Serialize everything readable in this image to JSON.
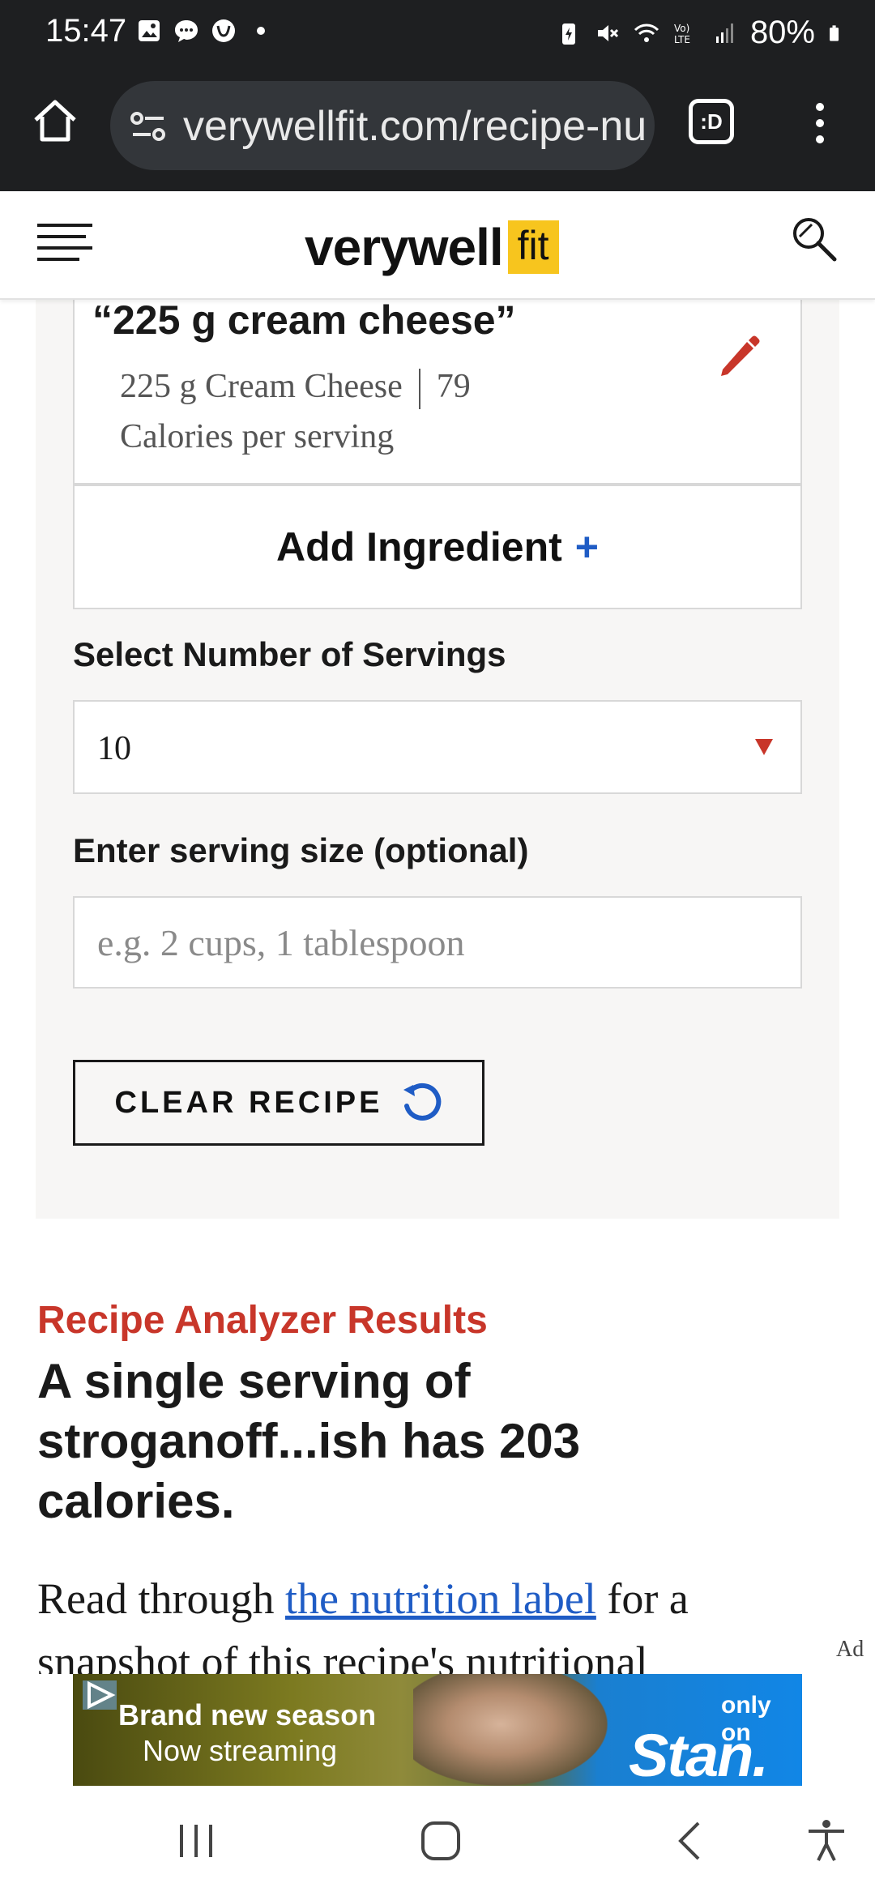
{
  "status_bar": {
    "time": "15:47",
    "battery": "80%",
    "notification_icons": [
      "gallery-icon",
      "chat-icon",
      "woolworths-icon",
      "dot-icon"
    ],
    "system_icons": [
      "battery-saver-icon",
      "mute-icon",
      "wifi-icon",
      "volte-icon",
      "signal-icon",
      "battery-icon"
    ]
  },
  "browser": {
    "url": "verywellfit.com/recipe-nu",
    "tab_label": ":D"
  },
  "site": {
    "logo_word": "verywell",
    "logo_badge": "fit"
  },
  "ingredient": {
    "title": "“225 g cream cheese”",
    "name": "225 g Cream Cheese",
    "calories": "79",
    "calories_label": "Calories per serving"
  },
  "calculator": {
    "add_ingredient_label": "Add Ingredient",
    "add_icon": "+",
    "servings_label": "Select Number of Servings",
    "servings_value": "10",
    "serving_size_label": "Enter serving size (optional)",
    "serving_size_placeholder": "e.g. 2 cups, 1 tablespoon",
    "serving_size_value": "",
    "clear_label": "CLEAR RECIPE"
  },
  "results": {
    "label": "Recipe Analyzer Results",
    "headline": "A single serving of stroganoff...ish has 203 calories.",
    "body_before": "Read through ",
    "body_link": "the nutrition label",
    "body_after": " for a snapshot of this recipe's nutritional"
  },
  "ad": {
    "tag": "Ad",
    "line1": "Brand new season",
    "line2": "Now streaming",
    "brand_small": "only on",
    "brand": "Stan."
  },
  "colors": {
    "accent_red": "#c8362a",
    "link_blue": "#1f5cc5",
    "logo_yellow": "#f7c51e",
    "panel_bg": "#f7f6f5",
    "status_bg": "#1e1f21"
  }
}
